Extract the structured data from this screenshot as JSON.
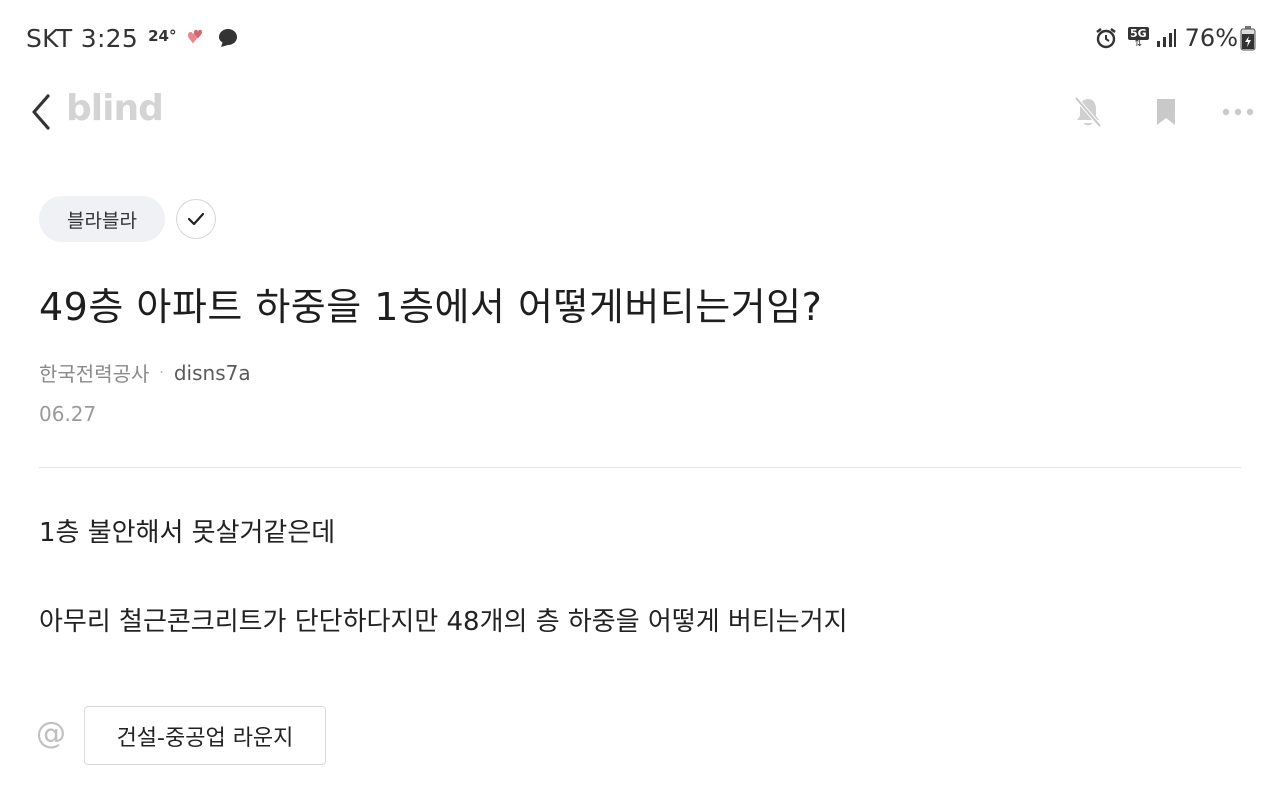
{
  "status_bar": {
    "carrier_time": "SKT 3:25",
    "temperature": "24°",
    "network": "5G",
    "battery": "76%"
  },
  "app_bar": {
    "brand": "blind",
    "icons": [
      "back-chevron-icon",
      "notification-off-icon",
      "bookmark-icon",
      "more-icon"
    ]
  },
  "post": {
    "board": "블라블라",
    "title": "49층 아파트 하중을 1층에서 어떻게버티는거임?",
    "company": "한국전력공사",
    "separator": "·",
    "username": "disns7a",
    "date": "06.27",
    "body": [
      "1층 불안해서 못살거같은데",
      "아무리 철근콘크리트가 단단하다지만 48개의 층 하중을 어떻게 버티는거지"
    ],
    "topic_prefix": "@",
    "topic": "건설-중공업 라운지"
  },
  "colors": {
    "brand_gray": "#d4d4d4",
    "chip_bg": "#f0f1f4",
    "muted_text": "#8a8a8a"
  }
}
